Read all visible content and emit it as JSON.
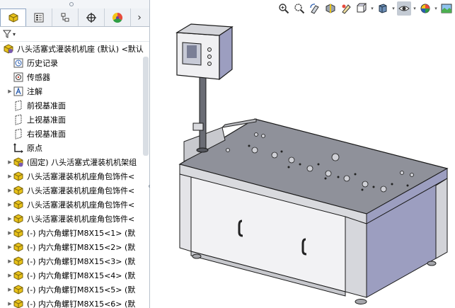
{
  "tabs": [
    {
      "name": "feature-manager",
      "icon": "feature-tree-icon",
      "active": true
    },
    {
      "name": "property-manager",
      "icon": "property-list-icon",
      "active": false
    },
    {
      "name": "configuration-manager",
      "icon": "configuration-icon",
      "active": false
    },
    {
      "name": "dimxpert-manager",
      "icon": "crosshair-icon",
      "active": false
    },
    {
      "name": "display-manager",
      "icon": "color-wheel-icon",
      "active": false
    }
  ],
  "tabs_more": "›",
  "filter": {
    "icon": "filter-icon",
    "arrow": "▾"
  },
  "tree": {
    "root": "八头活塞式灌装机机座 (默认) <默认",
    "items": [
      {
        "label": "历史记录",
        "icon": "history-icon",
        "expandable": false
      },
      {
        "label": "传感器",
        "icon": "sensor-icon",
        "expandable": false
      },
      {
        "label": "注解",
        "icon": "annotation-icon",
        "expandable": true
      },
      {
        "label": "前视基准面",
        "icon": "plane-icon",
        "expandable": false
      },
      {
        "label": "上视基准面",
        "icon": "plane-icon",
        "expandable": false
      },
      {
        "label": "右视基准面",
        "icon": "plane-icon",
        "expandable": false
      },
      {
        "label": "原点",
        "icon": "origin-icon",
        "expandable": false
      },
      {
        "label": "(固定) 八头活塞式灌装机机架组",
        "icon": "component-icon",
        "expandable": true
      },
      {
        "label": "八头活塞灌装机机座角包饰件<",
        "icon": "component-icon",
        "expandable": true
      },
      {
        "label": "八头活塞灌装机机座角包饰件<",
        "icon": "component-icon",
        "expandable": true
      },
      {
        "label": "八头活塞灌装机机座角包饰件<",
        "icon": "component-icon",
        "expandable": true
      },
      {
        "label": "八头活塞灌装机机座角包饰件<",
        "icon": "component-icon",
        "expandable": true
      },
      {
        "label": "(-) 内六角螺钉M8X15<1> (默",
        "icon": "component-icon",
        "expandable": true
      },
      {
        "label": "(-) 内六角螺钉M8X15<2> (默",
        "icon": "component-icon",
        "expandable": true
      },
      {
        "label": "(-) 内六角螺钉M8X15<3> (默",
        "icon": "component-icon",
        "expandable": true
      },
      {
        "label": "(-) 内六角螺钉M8X15<4> (默",
        "icon": "component-icon",
        "expandable": true
      },
      {
        "label": "(-) 内六角螺钉M8X15<5> (默",
        "icon": "component-icon",
        "expandable": true
      },
      {
        "label": "(-) 内六角螺钉M8X15<6> (默",
        "icon": "component-icon",
        "expandable": true
      }
    ]
  },
  "heads_up_toolbar": [
    {
      "name": "zoom-to-fit",
      "icon": "zoom-fit-icon"
    },
    {
      "name": "zoom-to-area",
      "icon": "zoom-area-icon"
    },
    {
      "name": "previous-view",
      "icon": "previous-view-icon"
    },
    {
      "name": "section-view",
      "icon": "section-view-icon"
    },
    {
      "name": "dynamic-annotation",
      "icon": "annotation-view-icon"
    },
    {
      "name": "view-orientation",
      "icon": "view-orientation-icon",
      "dropdown": true
    },
    {
      "name": "display-style",
      "icon": "display-style-icon",
      "dropdown": true
    },
    {
      "name": "hide-show-items",
      "icon": "hide-show-icon",
      "dropdown": true,
      "selected": true
    },
    {
      "name": "edit-appearance",
      "icon": "appearance-icon",
      "dropdown": true
    },
    {
      "name": "apply-scene",
      "icon": "scene-icon"
    }
  ],
  "colors": {
    "component_yellow": "#e8c21a",
    "component_purple": "#7a5bb0",
    "panel_border": "#b9c2cc",
    "machine_face": "#f2f2f4",
    "machine_top": "#8f919a",
    "machine_side": "#9c9ec0"
  }
}
